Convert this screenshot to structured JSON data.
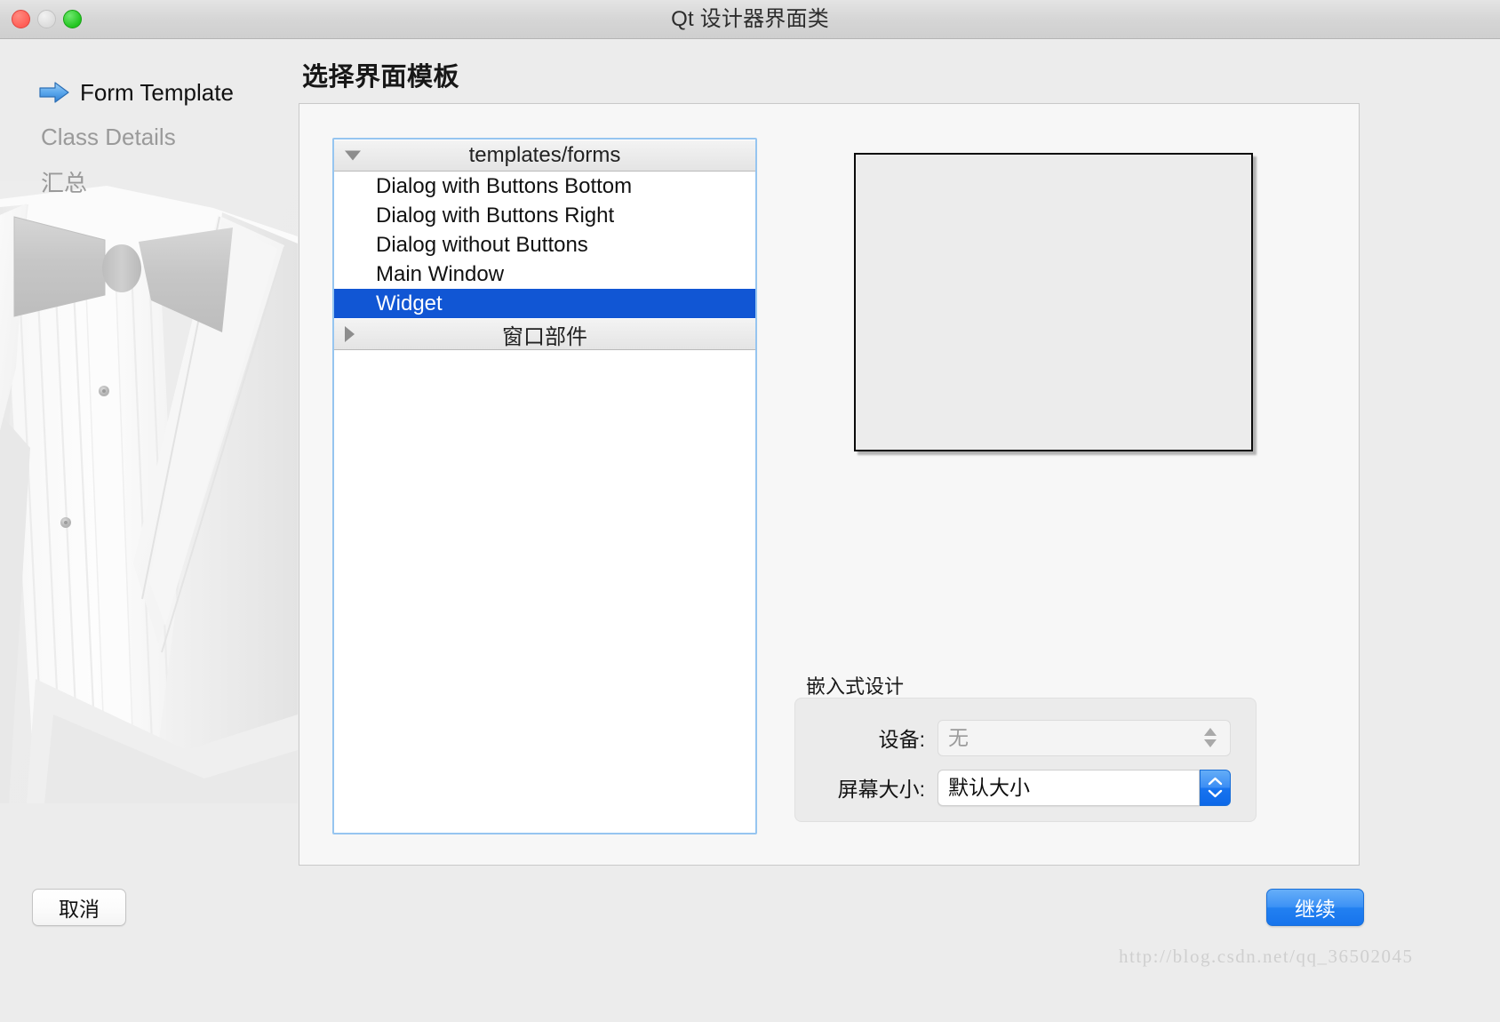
{
  "window": {
    "title": "Qt 设计器界面类",
    "traffic_lights": [
      {
        "name": "close",
        "color": "#ff5f57"
      },
      {
        "name": "minimize",
        "color": "#dcdcdc"
      },
      {
        "name": "zoom",
        "color": "#22c520"
      }
    ]
  },
  "sidebar": {
    "steps": [
      {
        "label": "Form Template",
        "state": "active",
        "icon": "blue-arrow-icon"
      },
      {
        "label": "Class Details",
        "state": "inactive"
      },
      {
        "label": "汇总",
        "state": "inactive"
      }
    ],
    "watermark_image": "tuxedo-illustration"
  },
  "main": {
    "page_title": "选择界面模板",
    "tree": {
      "groups": [
        {
          "header": "templates/forms",
          "expanded": true,
          "disclosure": "triangle-down-icon",
          "items": [
            {
              "label": "Dialog with Buttons Bottom",
              "selected": false
            },
            {
              "label": "Dialog with Buttons Right",
              "selected": false
            },
            {
              "label": "Dialog without Buttons",
              "selected": false
            },
            {
              "label": "Main Window",
              "selected": false
            },
            {
              "label": "Widget",
              "selected": true
            }
          ]
        },
        {
          "header": "窗口部件",
          "expanded": false,
          "disclosure": "triangle-right-icon",
          "items": []
        }
      ],
      "selection_color": "#1156d4",
      "focus_ring_color": "#96c5f0"
    },
    "preview": {
      "name": "form-preview",
      "background": "#ececec",
      "border": "#0b0b0b"
    },
    "embedded_design": {
      "group_label": "嵌入式设计",
      "fields": [
        {
          "label": "设备:",
          "value": "无",
          "enabled": false,
          "control": "combo-box-stepper"
        },
        {
          "label": "屏幕大小:",
          "value": "默认大小",
          "enabled": true,
          "control": "combo-box-stepper"
        }
      ]
    }
  },
  "footer": {
    "cancel_label": "取消",
    "continue_label": "继续",
    "watermark": "http://blog.csdn.net/qq_36502045",
    "continue_color": "#2280f1"
  }
}
